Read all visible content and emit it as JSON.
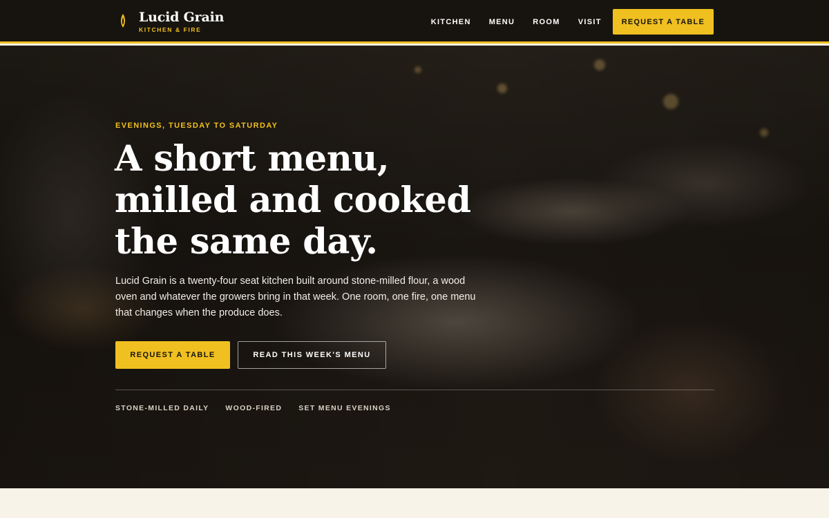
{
  "brand": {
    "name": "Lucid Grain",
    "tagline": "KITCHEN & FIRE",
    "mark_icon": "grain-flame-icon",
    "accent_color": "#f0c020"
  },
  "nav": {
    "links": [
      "KITCHEN",
      "MENU",
      "ROOM",
      "VISIT"
    ],
    "cta_label": "REQUEST A TABLE"
  },
  "hero": {
    "eyebrow": "EVENINGS, TUESDAY TO SATURDAY",
    "headline": "A short menu, milled and cooked the same day.",
    "lede": "Lucid Grain is a twenty-four seat kitchen built around stone-milled flour, a wood oven and whatever the growers bring in that week. One room, one fire, one menu that changes when the produce does.",
    "primary_button": "REQUEST A TABLE",
    "secondary_button": "READ THIS WEEK'S MENU",
    "features": [
      "STONE-MILLED DAILY",
      "WOOD-FIRED",
      "SET MENU EVENINGS"
    ]
  },
  "colors": {
    "topbar_bg": "#17140f",
    "page_bg": "#f7f3e8",
    "accent": "#f0c020"
  }
}
